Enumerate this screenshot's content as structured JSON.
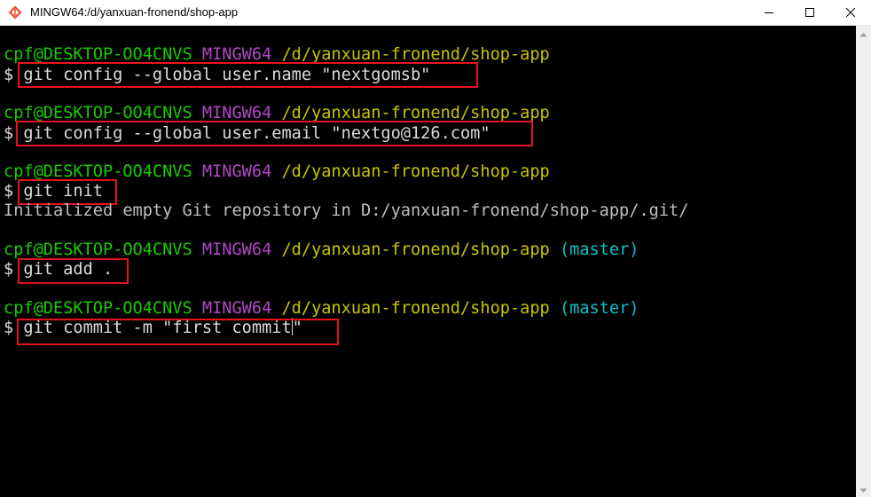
{
  "window": {
    "title": "MINGW64:/d/yanxuan-fronend/shop-app",
    "icon": "git-bash-icon",
    "buttons": {
      "minimize": "minimize-icon",
      "maximize": "maximize-icon",
      "close": "close-icon"
    }
  },
  "terminal": {
    "colors": {
      "background": "#000000",
      "user": "#19cb00",
      "msystem": "#b148c6",
      "path": "#c7c400",
      "branch": "#0ac1c9",
      "text": "#c0c0c0",
      "highlight_box": "#e8121b"
    },
    "prompt": {
      "user_host": "cpf@DESKTOP-OO4CNVS",
      "msystem": "MINGW64",
      "path": "/d/yanxuan-fronend/shop-app",
      "branch": "(master)",
      "symbol": "$"
    },
    "commands": [
      "git config --global user.name \"nextgomsb\"",
      "git config --global user.email \"nextgo@126.com\"",
      "git init",
      "git add .",
      "git commit -m \"first commit\""
    ],
    "outputs": {
      "init": "Initialized empty Git repository in D:/yanxuan-fronend/shop-app/.git/"
    },
    "current_input": "git commit -m \"first commit"
  },
  "scrollbar": {
    "up": "scroll-up-arrow-icon",
    "down": "scroll-down-arrow-icon"
  }
}
